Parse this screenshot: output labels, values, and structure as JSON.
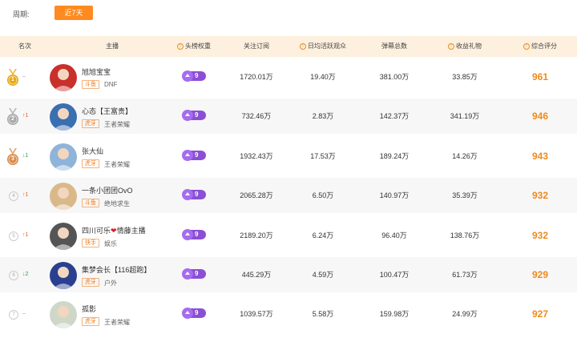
{
  "filter": {
    "period_label": "周期:",
    "period_value": "近7天"
  },
  "columns": {
    "rank": "名次",
    "streamer": "主播",
    "weight": "头榜权重",
    "followers": "关注订阅",
    "daily_active": "日均活跃观众",
    "danmaku": "弹幕总数",
    "gift_income": "收益礼物",
    "score": "综合评分"
  },
  "rows": [
    {
      "rank": "1",
      "medal": "gold",
      "trend": "–",
      "trend_dir": "same",
      "name": "旭旭宝宝",
      "platform": "斗鱼",
      "category": "DNF",
      "weight": "9",
      "followers": "1720.01万",
      "daily_active": "19.40万",
      "danmaku": "381.00万",
      "gift_income": "33.85万",
      "score": "961",
      "avatar_color": "#c9302c"
    },
    {
      "rank": "2",
      "medal": "silver",
      "trend": "↑1",
      "trend_dir": "up",
      "name": "心态【王富贵】",
      "platform": "虎牙",
      "category": "王者荣耀",
      "weight": "9",
      "followers": "732.46万",
      "daily_active": "2.83万",
      "danmaku": "142.37万",
      "gift_income": "341.19万",
      "score": "946",
      "avatar_color": "#3a6fb0"
    },
    {
      "rank": "3",
      "medal": "bronze",
      "trend": "↓1",
      "trend_dir": "down",
      "name": "张大仙",
      "platform": "虎牙",
      "category": "王者荣耀",
      "weight": "9",
      "followers": "1932.43万",
      "daily_active": "17.53万",
      "danmaku": "189.24万",
      "gift_income": "14.26万",
      "score": "943",
      "avatar_color": "#8fb4d9"
    },
    {
      "rank": "4",
      "medal": "",
      "trend": "↑1",
      "trend_dir": "up",
      "name": "一条小团团OvO",
      "platform": "斗鱼",
      "category": "绝地求生",
      "weight": "9",
      "followers": "2065.28万",
      "daily_active": "6.50万",
      "danmaku": "140.97万",
      "gift_income": "35.39万",
      "score": "932",
      "avatar_color": "#d9b98a"
    },
    {
      "rank": "5",
      "medal": "",
      "trend": "↑1",
      "trend_dir": "up",
      "name_a": "四川可乐",
      "name_b": "情藤主播",
      "heart": "❤",
      "platform": "快手",
      "category": "娱乐",
      "weight": "9",
      "followers": "2189.20万",
      "daily_active": "6.24万",
      "danmaku": "96.40万",
      "gift_income": "138.76万",
      "score": "932",
      "avatar_color": "#555555"
    },
    {
      "rank": "6",
      "medal": "",
      "trend": "↓2",
      "trend_dir": "down",
      "name": "集梦会长【116超跑】",
      "platform": "虎牙",
      "category": "户外",
      "weight": "9",
      "followers": "445.29万",
      "daily_active": "4.59万",
      "danmaku": "100.47万",
      "gift_income": "61.73万",
      "score": "929",
      "avatar_color": "#2a3f8f"
    },
    {
      "rank": "7",
      "medal": "",
      "trend": "–",
      "trend_dir": "same",
      "name": "孤影",
      "platform": "虎牙",
      "category": "王者荣耀",
      "weight": "9",
      "followers": "1039.57万",
      "daily_active": "5.58万",
      "danmaku": "159.98万",
      "gift_income": "24.99万",
      "score": "927",
      "avatar_color": "#cfd8c8"
    }
  ],
  "colors": {
    "accent": "#f08a1c",
    "header_bg": "#fdf0de",
    "weight_badge": "#8b4fd6",
    "up": "#f05a1c",
    "down": "#2aa44a"
  }
}
